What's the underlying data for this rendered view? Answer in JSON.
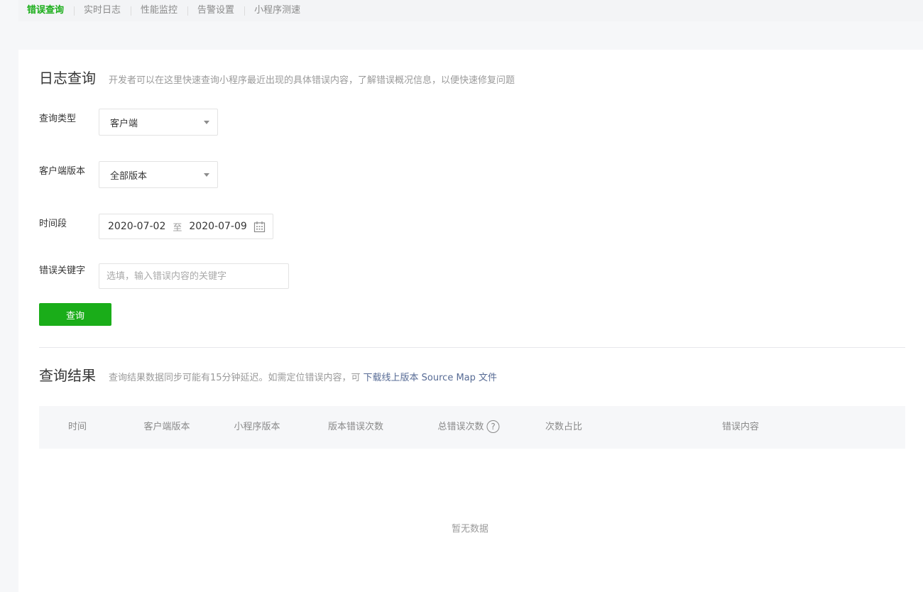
{
  "tabs": [
    {
      "label": "错误查询",
      "active": true
    },
    {
      "label": "实时日志",
      "active": false
    },
    {
      "label": "性能监控",
      "active": false
    },
    {
      "label": "告警设置",
      "active": false
    },
    {
      "label": "小程序测速",
      "active": false
    }
  ],
  "log_query": {
    "title": "日志查询",
    "description": "开发者可以在这里快速查询小程序最近出现的具体错误内容，了解错误概况信息，以便快速修复问题"
  },
  "form": {
    "query_type_label": "查询类型",
    "query_type_value": "客户端",
    "client_version_label": "客户端版本",
    "client_version_value": "全部版本",
    "time_range_label": "时间段",
    "date_start": "2020-07-02",
    "date_separator": "至",
    "date_end": "2020-07-09",
    "keyword_label": "错误关键字",
    "keyword_placeholder": "选填，输入错误内容的关键字",
    "keyword_value": "",
    "query_button": "查询"
  },
  "results": {
    "title": "查询结果",
    "description": "查询结果数据同步可能有15分钟延迟。如需定位错误内容，可",
    "link_text": "下载线上版本 Source Map 文件",
    "columns": [
      "时间",
      "客户端版本",
      "小程序版本",
      "版本错误次数",
      "总错误次数",
      "次数占比",
      "错误内容"
    ],
    "help_symbol": "?",
    "empty_text": "暂无数据"
  },
  "colors": {
    "accent": "#1aad19",
    "link": "#576b95"
  },
  "icons": [
    "calendar-icon",
    "help-circle-icon",
    "caret-down-icon"
  ]
}
